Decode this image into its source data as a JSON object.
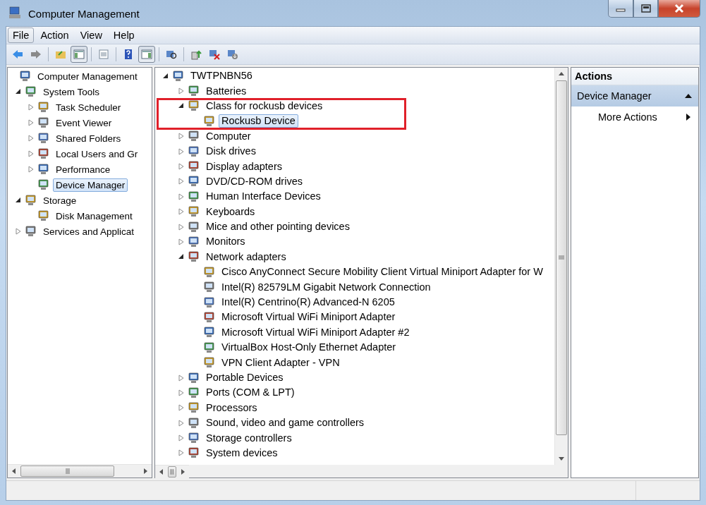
{
  "window": {
    "title": "Computer Management"
  },
  "menu": [
    {
      "label": "File",
      "selected": true
    },
    {
      "label": "Action",
      "selected": false
    },
    {
      "label": "View",
      "selected": false
    },
    {
      "label": "Help",
      "selected": false
    }
  ],
  "toolbar": [
    {
      "kind": "button",
      "pressed": false
    },
    {
      "kind": "button",
      "pressed": false
    },
    {
      "kind": "separator"
    },
    {
      "kind": "button",
      "pressed": false
    },
    {
      "kind": "button",
      "pressed": true
    },
    {
      "kind": "separator"
    },
    {
      "kind": "button",
      "pressed": false
    },
    {
      "kind": "separator"
    },
    {
      "kind": "button",
      "pressed": false
    },
    {
      "kind": "button",
      "pressed": true
    },
    {
      "kind": "separator"
    },
    {
      "kind": "button",
      "pressed": false
    },
    {
      "kind": "separator"
    },
    {
      "kind": "button",
      "pressed": false
    },
    {
      "kind": "button",
      "pressed": false
    },
    {
      "kind": "button",
      "pressed": false
    }
  ],
  "console_tree": [
    {
      "label": "Computer Management",
      "selected": false,
      "children": [
        {
          "label": "System Tools",
          "selected": false,
          "expanded": true,
          "children": [
            {
              "label": "Task Scheduler",
              "selected": false,
              "expanded": false
            },
            {
              "label": "Event Viewer",
              "selected": false,
              "expanded": false
            },
            {
              "label": "Shared Folders",
              "selected": false,
              "expanded": false
            },
            {
              "label": "Local Users and Gr",
              "selected": false,
              "expanded": false
            },
            {
              "label": "Performance",
              "selected": false,
              "expanded": false
            },
            {
              "label": "Device Manager",
              "selected": true
            }
          ]
        },
        {
          "label": "Storage",
          "selected": false,
          "expanded": true,
          "children": [
            {
              "label": "Disk Management",
              "selected": false
            }
          ]
        },
        {
          "label": "Services and Applicat",
          "selected": false,
          "expanded": false
        }
      ]
    }
  ],
  "device_tree": [
    {
      "label": "TWTPNBN56",
      "selected": false,
      "expanded": true,
      "children": [
        {
          "label": "Batteries",
          "selected": false,
          "expanded": false
        },
        {
          "label": "Class for rockusb devices",
          "selected": false,
          "expanded": true,
          "annotated": true,
          "children": [
            {
              "label": "Rockusb Device",
              "selected": true
            }
          ]
        },
        {
          "label": "Computer",
          "selected": false,
          "expanded": false
        },
        {
          "label": "Disk drives",
          "selected": false,
          "expanded": false
        },
        {
          "label": "Display adapters",
          "selected": false,
          "expanded": false
        },
        {
          "label": "DVD/CD-ROM drives",
          "selected": false,
          "expanded": false
        },
        {
          "label": "Human Interface Devices",
          "selected": false,
          "expanded": false
        },
        {
          "label": "Keyboards",
          "selected": false,
          "expanded": false
        },
        {
          "label": "Mice and other pointing devices",
          "selected": false,
          "expanded": false
        },
        {
          "label": "Monitors",
          "selected": false,
          "expanded": false
        },
        {
          "label": "Network adapters",
          "selected": false,
          "expanded": true,
          "children": [
            {
              "label": "Cisco AnyConnect Secure Mobility Client Virtual Miniport Adapter for W",
              "selected": false
            },
            {
              "label": "Intel(R) 82579LM Gigabit Network Connection",
              "selected": false
            },
            {
              "label": "Intel(R) Centrino(R) Advanced-N 6205",
              "selected": false
            },
            {
              "label": "Microsoft Virtual WiFi Miniport Adapter",
              "selected": false
            },
            {
              "label": "Microsoft Virtual WiFi Miniport Adapter #2",
              "selected": false
            },
            {
              "label": "VirtualBox Host-Only Ethernet Adapter",
              "selected": false
            },
            {
              "label": "VPN Client Adapter - VPN",
              "selected": false
            }
          ]
        },
        {
          "label": "Portable Devices",
          "selected": false,
          "expanded": false
        },
        {
          "label": "Ports (COM & LPT)",
          "selected": false,
          "expanded": false
        },
        {
          "label": "Processors",
          "selected": false,
          "expanded": false
        },
        {
          "label": "Sound, video and game controllers",
          "selected": false,
          "expanded": false
        },
        {
          "label": "Storage controllers",
          "selected": false,
          "expanded": false
        },
        {
          "label": "System devices",
          "selected": false,
          "expanded": false
        }
      ]
    }
  ],
  "actions": {
    "title": "Actions",
    "sections": [
      {
        "title": "Device Manager",
        "expanded": true,
        "items": [
          {
            "label": "More Actions",
            "submenu": true
          }
        ]
      }
    ]
  }
}
